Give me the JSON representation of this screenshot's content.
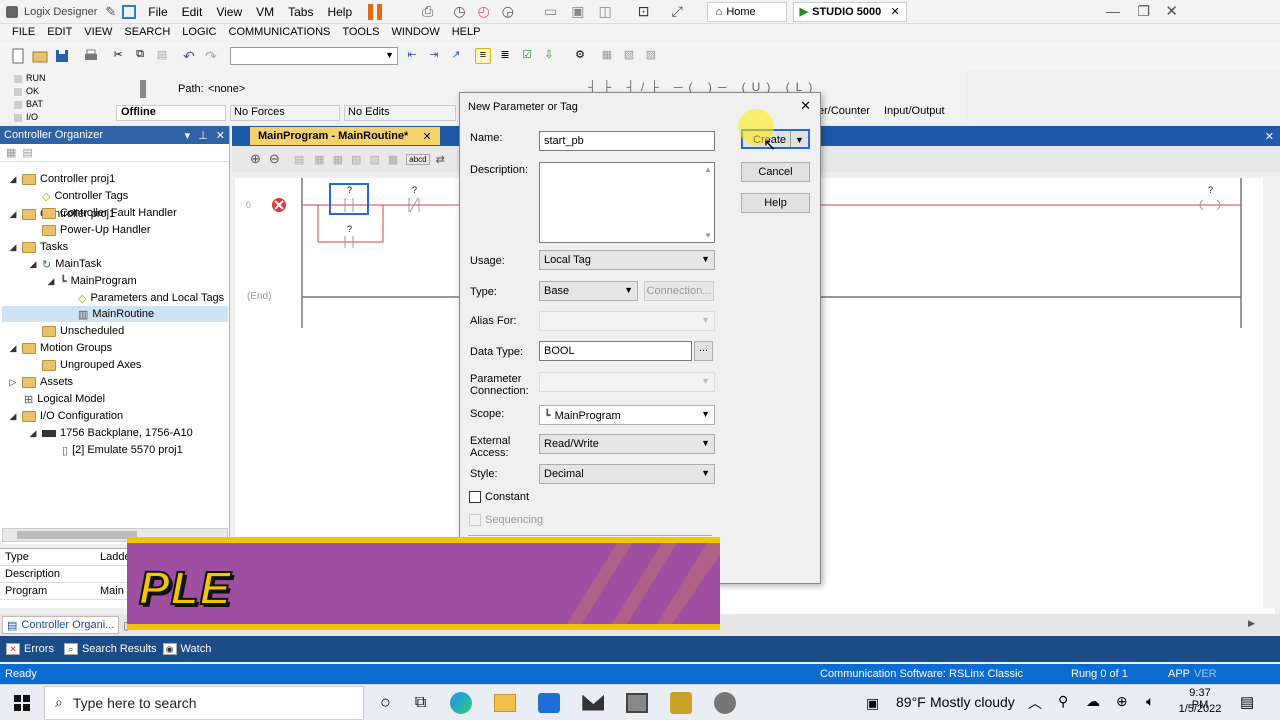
{
  "app": {
    "title": "Logix Designer"
  },
  "window_menu": [
    "File",
    "Edit",
    "View",
    "VM",
    "Tabs",
    "Help"
  ],
  "browser_tabs": [
    {
      "label": "Home"
    },
    {
      "label": "STUDIO 5000"
    }
  ],
  "menubar": [
    "FILE",
    "EDIT",
    "VIEW",
    "SEARCH",
    "LOGIC",
    "COMMUNICATIONS",
    "TOOLS",
    "WINDOW",
    "HELP"
  ],
  "controller_status": {
    "run": "RUN",
    "ok": "OK",
    "bat": "BAT",
    "io": "I/O",
    "mode": "Offline",
    "forces": "No Forces",
    "edits": "No Edits",
    "path_label": "Path:",
    "path_value": "<none>"
  },
  "instruction_tabs": [
    "er/Counter",
    "Input/Output"
  ],
  "organizer": {
    "title": "Controller Organizer",
    "items": [
      {
        "label": "Controller proj1"
      },
      {
        "label": "Controller Tags"
      },
      {
        "label": "Controller Fault Handler"
      },
      {
        "label": "Power-Up Handler"
      },
      {
        "label": "Tasks"
      },
      {
        "label": "MainTask"
      },
      {
        "label": "MainProgram"
      },
      {
        "label": "Parameters and Local Tags"
      },
      {
        "label": "MainRoutine"
      },
      {
        "label": "Unscheduled"
      },
      {
        "label": "Motion Groups"
      },
      {
        "label": "Ungrouped Axes"
      },
      {
        "label": "Assets"
      },
      {
        "label": "Logical Model"
      },
      {
        "label": "I/O Configuration"
      },
      {
        "label": "1756 Backplane, 1756-A10"
      },
      {
        "label": "[2] Emulate 5570 proj1"
      }
    ]
  },
  "properties": [
    {
      "key": "Type",
      "value": "Ladde"
    },
    {
      "key": "Description",
      "value": ""
    },
    {
      "key": "Program",
      "value": "Main"
    }
  ],
  "editor": {
    "tab": "MainProgram - MainRoutine*",
    "rung0": "0",
    "end": "(End)",
    "q": "?"
  },
  "bottom_tabs": [
    "Controller Organi..."
  ],
  "output_tabs": [
    "Errors",
    "Search Results",
    "Watch"
  ],
  "statusbar": {
    "ready": "Ready",
    "comm": "Communication Software: RSLinx Classic",
    "rung": "Rung 0 of 1",
    "app": "APP",
    "ver": "VER"
  },
  "dialog": {
    "title": "New Parameter or Tag",
    "name_label": "Name:",
    "name_value": "start_pb",
    "description_label": "Description:",
    "usage_label": "Usage:",
    "usage_value": "Local Tag",
    "type_label": "Type:",
    "type_value": "Base",
    "connection_button": "Connection...",
    "alias_label": "Alias For:",
    "datatype_label": "Data Type:",
    "datatype_value": "BOOL",
    "browse_button": "...",
    "param_conn_label": "Parameter Connection:",
    "scope_label": "Scope:",
    "scope_value": "MainProgram",
    "ext_access_label": "External Access:",
    "ext_access_value": "Read/Write",
    "style_label": "Style:",
    "style_value": "Decimal",
    "constant_label": "Constant",
    "sequencing_label": "Sequencing",
    "create_button": "Create",
    "cancel_button": "Cancel",
    "help_button": "Help"
  },
  "banner": {
    "text": "PLE"
  },
  "taskbar": {
    "search_placeholder": "Type here to search",
    "temperature": "89°F",
    "weather": "Mostly cloudy",
    "time": "9:37 PM",
    "date": "1/5/2022"
  },
  "colors": {
    "accent": "#1e5aa8",
    "banner": "#9e4fa2",
    "banner_border": "#f2c500",
    "status": "#0a6bd1"
  }
}
